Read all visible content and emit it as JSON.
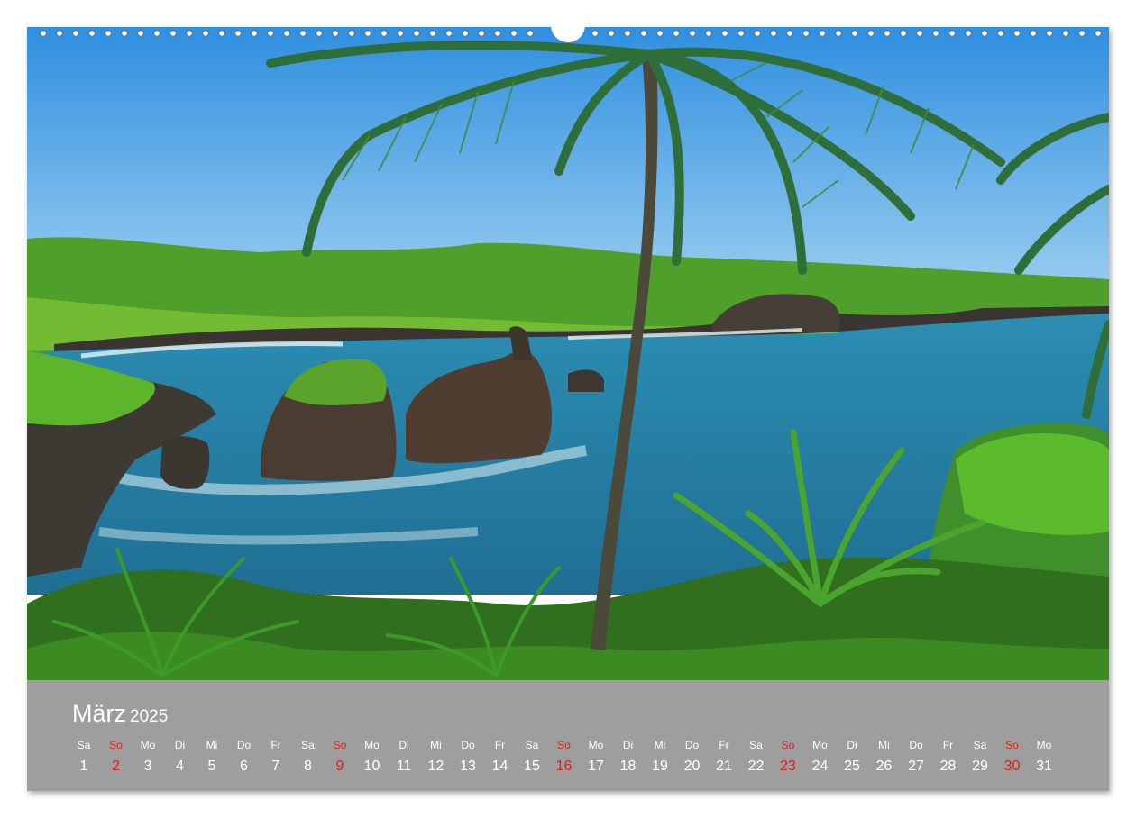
{
  "photo": {
    "subject": "tropical-coast-palm-photo"
  },
  "calendar": {
    "month": "März",
    "year": "2025",
    "sunday_color": "#e0201b",
    "days": [
      {
        "wd": "Sa",
        "d": "1"
      },
      {
        "wd": "So",
        "d": "2"
      },
      {
        "wd": "Mo",
        "d": "3"
      },
      {
        "wd": "Di",
        "d": "4"
      },
      {
        "wd": "Mi",
        "d": "5"
      },
      {
        "wd": "Do",
        "d": "6"
      },
      {
        "wd": "Fr",
        "d": "7"
      },
      {
        "wd": "Sa",
        "d": "8"
      },
      {
        "wd": "So",
        "d": "9"
      },
      {
        "wd": "Mo",
        "d": "10"
      },
      {
        "wd": "Di",
        "d": "11"
      },
      {
        "wd": "Mi",
        "d": "12"
      },
      {
        "wd": "Do",
        "d": "13"
      },
      {
        "wd": "Fr",
        "d": "14"
      },
      {
        "wd": "Sa",
        "d": "15"
      },
      {
        "wd": "So",
        "d": "16"
      },
      {
        "wd": "Mo",
        "d": "17"
      },
      {
        "wd": "Di",
        "d": "18"
      },
      {
        "wd": "Mi",
        "d": "19"
      },
      {
        "wd": "Do",
        "d": "20"
      },
      {
        "wd": "Fr",
        "d": "21"
      },
      {
        "wd": "Sa",
        "d": "22"
      },
      {
        "wd": "So",
        "d": "23"
      },
      {
        "wd": "Mo",
        "d": "24"
      },
      {
        "wd": "Di",
        "d": "25"
      },
      {
        "wd": "Mi",
        "d": "26"
      },
      {
        "wd": "Do",
        "d": "27"
      },
      {
        "wd": "Fr",
        "d": "28"
      },
      {
        "wd": "Sa",
        "d": "29"
      },
      {
        "wd": "So",
        "d": "30"
      },
      {
        "wd": "Mo",
        "d": "31"
      }
    ]
  }
}
